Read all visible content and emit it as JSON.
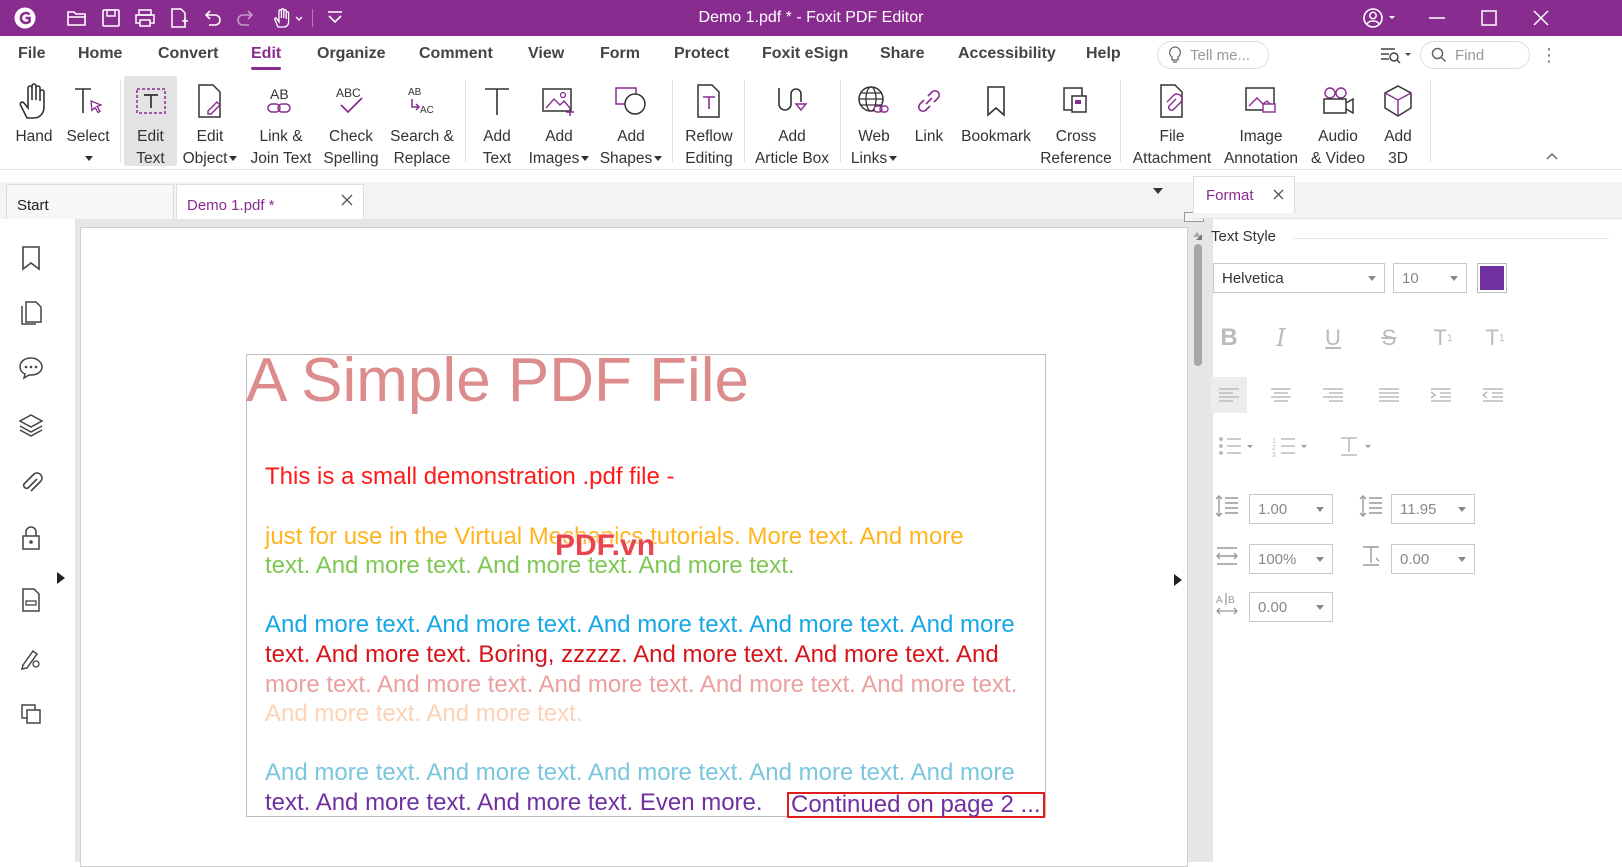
{
  "titlebar": {
    "title": "Demo 1.pdf * - Foxit PDF Editor"
  },
  "menu": {
    "items": [
      "File",
      "Home",
      "Convert",
      "Edit",
      "Organize",
      "Comment",
      "View",
      "Form",
      "Protect",
      "Foxit eSign",
      "Share",
      "Accessibility",
      "Help"
    ],
    "tell_me_placeholder": "Tell me...",
    "find_placeholder": "Find"
  },
  "ribbon": {
    "hand": [
      "Hand"
    ],
    "select": [
      "Select"
    ],
    "edit_text": [
      "Edit",
      "Text"
    ],
    "edit_object": [
      "Edit",
      "Object"
    ],
    "link_join": [
      "Link &",
      "Join Text"
    ],
    "check_spelling": [
      "Check",
      "Spelling"
    ],
    "search_replace": [
      "Search &",
      "Replace"
    ],
    "add_text": [
      "Add",
      "Text"
    ],
    "add_images": [
      "Add",
      "Images"
    ],
    "add_shapes": [
      "Add",
      "Shapes"
    ],
    "reflow": [
      "Reflow",
      "Editing"
    ],
    "article_box": [
      "Add",
      "Article Box"
    ],
    "web_links": [
      "Web",
      "Links"
    ],
    "link": [
      "Link"
    ],
    "bookmark": [
      "Bookmark"
    ],
    "cross_ref": [
      "Cross",
      "Reference"
    ],
    "file_attach": [
      "File",
      "Attachment"
    ],
    "image_annot": [
      "Image",
      "Annotation"
    ],
    "audio_video": [
      "Audio",
      "& Video"
    ],
    "add_3d": [
      "Add",
      "3D"
    ]
  },
  "tabs": {
    "start": "Start",
    "doc": "Demo 1.pdf *"
  },
  "pdf": {
    "title": "A Simple PDF File",
    "watermark": "PDF.vn",
    "lines": [
      {
        "text": "This is a small demonstration .pdf file -",
        "color": "#ff1a1a"
      },
      {
        "text": "just for use in the Virtual Mechanics tutorials. More text. And more",
        "color": "#ffb41e"
      },
      {
        "text": "text. And more text. And more text. And more text.",
        "color": "#7dc853"
      },
      {
        "text": "And more text. And more text. And more text. And more text. And more",
        "color": "#15a7e6"
      },
      {
        "text": "text. And more text. Boring, zzzzz. And more text. And more text. And",
        "color": "#d6141a"
      },
      {
        "text": "more text. And more text. And more text. And more text. And more text.",
        "color": "#eba0a0"
      },
      {
        "text": "And more text. And more text.",
        "color": "#fdd2b4"
      },
      {
        "text": "And more text. And more text. And more text. And more text. And more",
        "color": "#79c6de"
      },
      {
        "text": "text. And more text. And more text. Even more.",
        "color": "#7030a0"
      }
    ],
    "selected": "Continued on page 2 ..."
  },
  "format_panel": {
    "tab": "Format",
    "section": "Text Style",
    "font": "Helvetica",
    "size": "10",
    "color": "#7030a0",
    "line_spacing": "1.00",
    "char_spacing": "11.95",
    "horizontal_scale": "100%",
    "baseline_offset": "0.00",
    "word_spacing": "0.00"
  }
}
